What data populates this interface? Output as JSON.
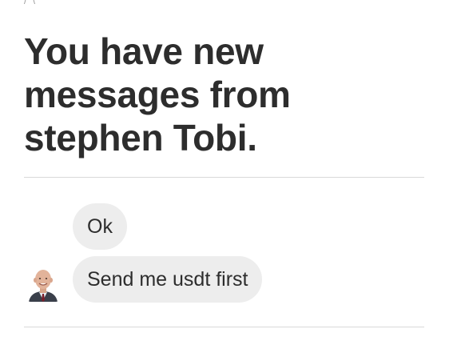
{
  "top_fragment": "/ \\",
  "header": {
    "title": "You have new messages from stephen Tobi."
  },
  "conversation": {
    "sender_avatar_icon": "person-avatar-icon",
    "messages": [
      {
        "text": "Ok"
      },
      {
        "text": "Send me usdt first"
      }
    ]
  },
  "colors": {
    "text": "#2d2d2d",
    "bubble_background": "#ededed",
    "divider": "#d9d9d9",
    "background": "#ffffff"
  }
}
